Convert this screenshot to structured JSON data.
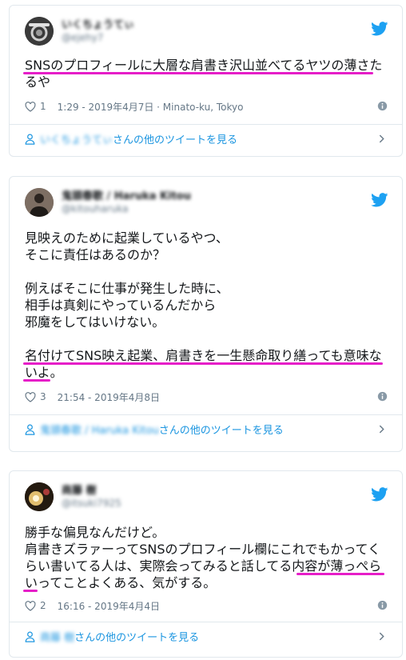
{
  "colors": {
    "accent": "#1b95e0",
    "highlight": "#e61ec8",
    "muted": "#657786"
  },
  "tweets": [
    {
      "display_name": "いくちょうてぃ",
      "handle": "@ejehy7",
      "avatar": "headphones",
      "lines": [
        "SNSのプロフィールに大層な肩書き沢山並べてるヤツの薄さた",
        "るや"
      ],
      "likes": "1",
      "timestamp": "1:29 - 2019年4月7日 · Minato-ku, Tokyo",
      "more_name": "いくちょうてぃ",
      "more_suffix": "さんの他のツイートを見る"
    },
    {
      "display_name": "鬼頭春歌 / Haruka Kitou",
      "handle": "@kitouharuka",
      "avatar": "person",
      "lines": [
        "見映えのために起業しているやつ、",
        "そこに責任はあるのか？",
        "",
        "例えばそこに仕事が発生した時に、",
        "相手は真剣にやっているんだから",
        "邪魔をしてはいけない。",
        "",
        "名付けてSNS映え起業、肩書きを一生懸命取り繕っても意味な",
        "いよ。"
      ],
      "likes": "3",
      "timestamp": "21:54 - 2019年4月8日",
      "more_name": "鬼頭春歌 / Haruka Kitou",
      "more_suffix": "さんの他のツイートを見る"
    },
    {
      "display_name": "商藤 樹",
      "handle": "@itsuki7925",
      "avatar": "light",
      "lines": [
        "勝手な偏見なんだけど。",
        "肩書きズラァーってSNSのプロフィール欄にこれでもかってく",
        "らい書いてる人は、実際会ってみると話してる内容が薄っぺら",
        "いってことよくある、気がする。"
      ],
      "likes": "2",
      "timestamp": "16:16 - 2019年4月4日",
      "more_name": "商藤 樹",
      "more_suffix": "さんの他のツイートを見る"
    }
  ]
}
